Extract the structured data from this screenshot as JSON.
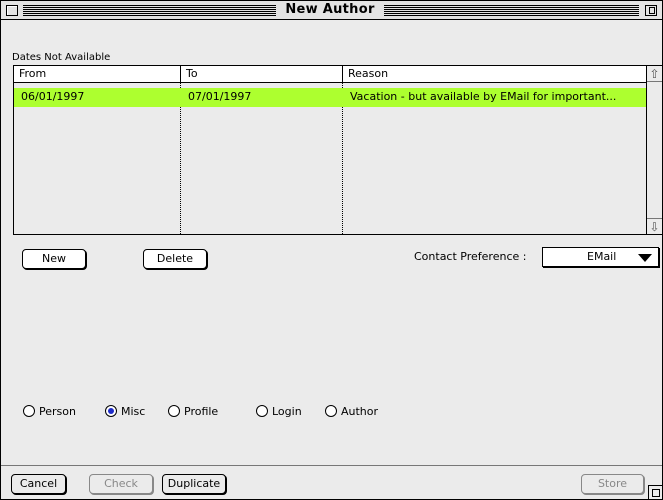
{
  "window": {
    "title": "New Author"
  },
  "dates": {
    "section_label": "Dates Not Available",
    "columns": [
      "From",
      "To",
      "Reason"
    ],
    "rows": [
      {
        "from": "06/01/1997",
        "to": "07/01/1997",
        "reason": "Vacation - but available by EMail for important..."
      }
    ],
    "selected_row_color": "#adff2f"
  },
  "actions": {
    "new_label": "New",
    "delete_label": "Delete"
  },
  "contact_preference": {
    "label": "Contact Preference :",
    "value": "EMail"
  },
  "tabs": [
    {
      "label": "Person",
      "selected": false
    },
    {
      "label": "Misc",
      "selected": true
    },
    {
      "label": "Profile",
      "selected": false
    },
    {
      "label": "Login",
      "selected": false
    },
    {
      "label": "Author",
      "selected": false
    }
  ],
  "footer": {
    "cancel_label": "Cancel",
    "check_label": "Check",
    "duplicate_label": "Duplicate",
    "store_label": "Store"
  },
  "icons": {
    "close": "close-box-icon",
    "zoom": "zoom-box-icon",
    "scroll_up": "scroll-up-arrow-icon",
    "scroll_down": "scroll-down-arrow-icon",
    "popup": "popup-arrow-icon",
    "grow": "resize-grow-icon"
  }
}
